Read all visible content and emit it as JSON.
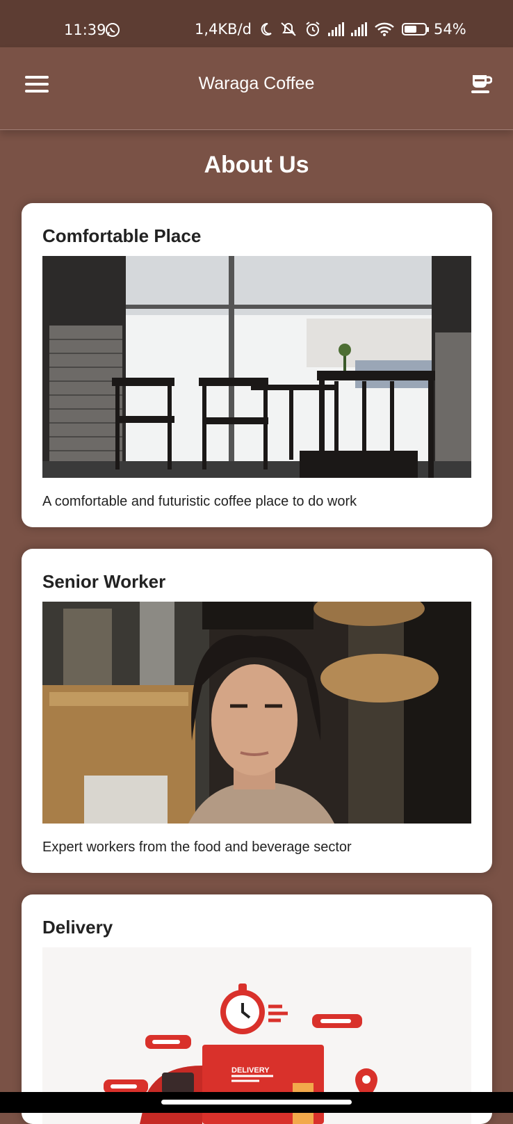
{
  "status_bar": {
    "time": "11:39",
    "net_speed": "1,4KB/d",
    "battery": "54%"
  },
  "app_bar": {
    "title": "Waraga Coffee",
    "menu_icon": "menu-icon",
    "action_icon": "coffee-cup-icon"
  },
  "page": {
    "title": "About Us"
  },
  "cards": [
    {
      "title": "Comfortable Place",
      "description": "A comfortable and futuristic coffee place to do work",
      "image": "cafe-interior-photo"
    },
    {
      "title": "Senior Worker",
      "description": "Expert workers from the food and beverage sector",
      "image": "barista-portrait-photo"
    },
    {
      "title": "Delivery",
      "description": "",
      "image": "delivery-truck-illustration"
    }
  ],
  "illustration": {
    "truck_label": "DELIVERY"
  },
  "colors": {
    "background": "#7a5246",
    "status_bar": "#5d3d33",
    "card": "#ffffff",
    "accent_red": "#d9312b"
  }
}
